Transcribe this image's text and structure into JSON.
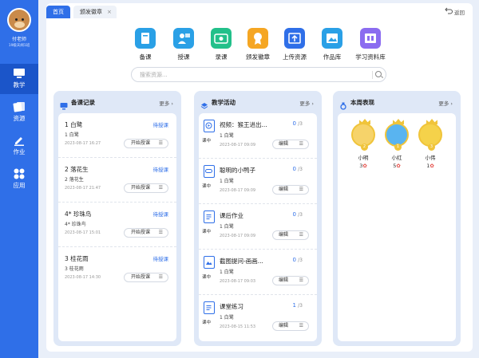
{
  "teacher": {
    "name": "付老师",
    "class": "19级天闻1班"
  },
  "nav": [
    {
      "label": "教学"
    },
    {
      "label": "资源"
    },
    {
      "label": "作业"
    },
    {
      "label": "应用"
    }
  ],
  "tabs": [
    {
      "label": "首页"
    },
    {
      "label": "颁发徽章"
    }
  ],
  "back_label": "返回",
  "toolbar": [
    {
      "label": "备课",
      "color": "#2aa0e6"
    },
    {
      "label": "授课",
      "color": "#2aa0e6"
    },
    {
      "label": "录课",
      "color": "#22c08a"
    },
    {
      "label": "颁发徽章",
      "color": "#f5a623"
    },
    {
      "label": "上传资源",
      "color": "#2f6fe8"
    },
    {
      "label": "作品库",
      "color": "#2aa0e6"
    },
    {
      "label": "学习资料库",
      "color": "#8b6cf0"
    }
  ],
  "search": {
    "placeholder": "搜索资源..."
  },
  "panels": {
    "prep": {
      "title": "备课记录",
      "more": "更多",
      "items": [
        {
          "name": "1 白鹭",
          "sub": "1 白鹭",
          "date": "2023-08-17 16:27",
          "status": "待授课",
          "button": "开始授课"
        },
        {
          "name": "2 落花生",
          "sub": "2 落花生",
          "date": "2023-08-17 21:47",
          "status": "待授课",
          "button": "开始授课"
        },
        {
          "name": "4* 珍珠鸟",
          "sub": "4* 珍珠鸟",
          "date": "2023-08-17 15:01",
          "status": "待授课",
          "button": "开始授课"
        },
        {
          "name": "3 桂花雨",
          "sub": "3 桂花雨",
          "date": "2023-08-17 14:30",
          "status": "待授课",
          "button": "开始授课"
        }
      ]
    },
    "activity": {
      "title": "教学活动",
      "more": "更多",
      "items": [
        {
          "name": "视频：猴王进出...",
          "sub": "1 白鹭",
          "status": "课中",
          "date": "2023-08-17 09:09",
          "count": "0",
          "total": "/3",
          "button": "编辑"
        },
        {
          "name": "聪明的小鸭子",
          "sub": "1 白鹭",
          "status": "课中",
          "date": "2023-08-17 09:09",
          "count": "0",
          "total": "/3",
          "button": "编辑"
        },
        {
          "name": "课后作业",
          "sub": "1 白鹭",
          "status": "课中",
          "date": "2023-08-17 09:09",
          "count": "0",
          "total": "/3",
          "button": "编辑"
        },
        {
          "name": "截图提问-画画...",
          "sub": "1 白鹭",
          "status": "课中",
          "date": "2023-08-17 09:03",
          "count": "0",
          "total": "/3",
          "button": "编辑"
        },
        {
          "name": "课堂练习",
          "sub": "1 白鹭",
          "status": "课中",
          "date": "2023-08-15 11:53",
          "count": "1",
          "total": "/3",
          "button": "编辑"
        }
      ]
    },
    "weekly": {
      "title": "本周表现",
      "more": "更多",
      "students": [
        {
          "name": "小明",
          "score": "3",
          "rank": "2",
          "color": "#f6d36a"
        },
        {
          "name": "小红",
          "score": "5",
          "rank": "1",
          "color": "#59b4f0"
        },
        {
          "name": "小伟",
          "score": "1",
          "rank": "3",
          "color": "#f5d24a"
        }
      ]
    }
  }
}
